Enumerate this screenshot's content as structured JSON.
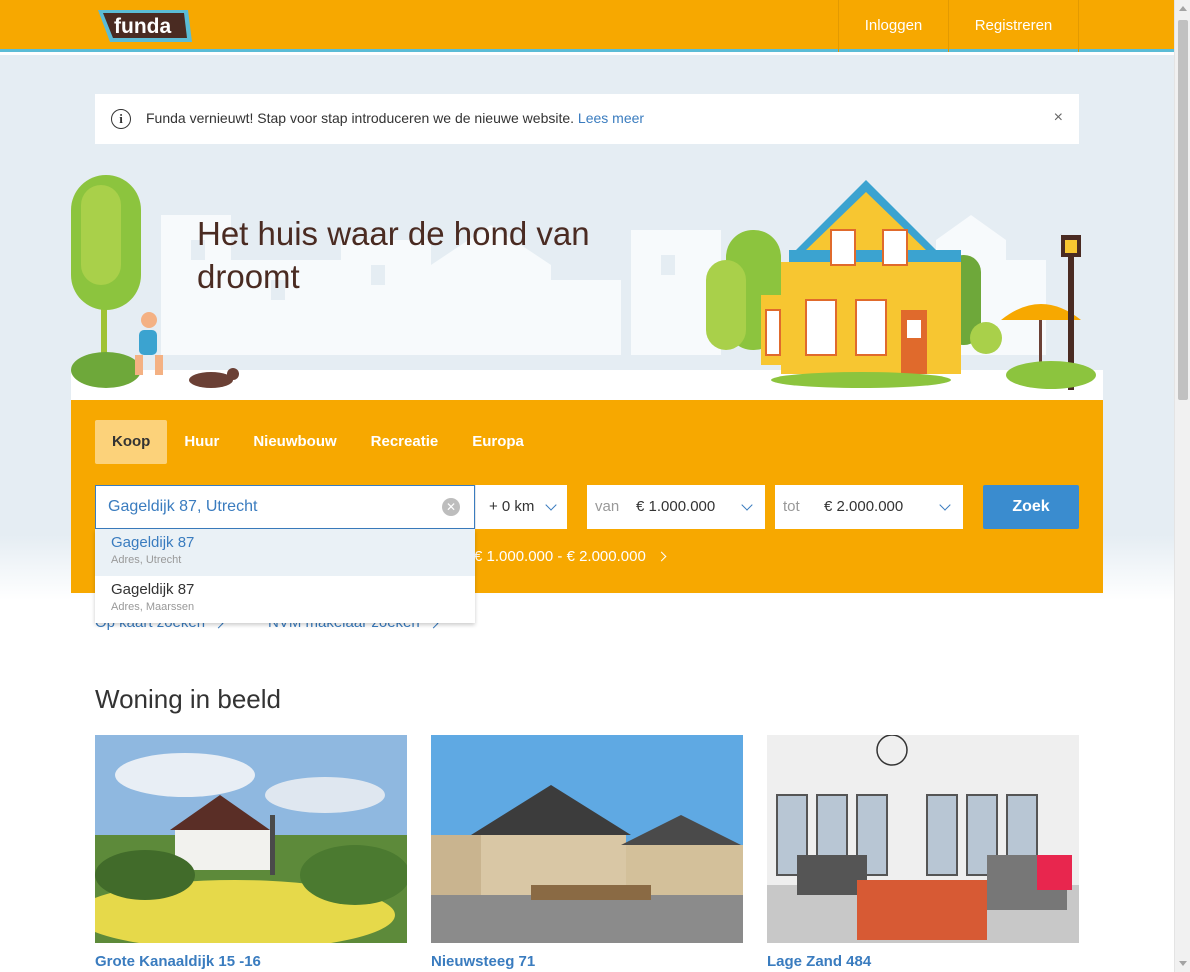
{
  "header": {
    "logo_text": "funda",
    "login_label": "Inloggen",
    "register_label": "Registreren"
  },
  "notice": {
    "icon": "info-icon",
    "text": "Funda vernieuwt! Stap voor stap introduceren we de nieuwe website.",
    "link_label": "Lees meer",
    "close_glyph": "×"
  },
  "hero": {
    "title": "Het huis waar de hond van droomt"
  },
  "search": {
    "tabs": [
      {
        "label": "Koop",
        "active": true
      },
      {
        "label": "Huur",
        "active": false
      },
      {
        "label": "Nieuwbouw",
        "active": false
      },
      {
        "label": "Recreatie",
        "active": false
      },
      {
        "label": "Europa",
        "active": false
      }
    ],
    "location_value": "Gageldijk 87, Utrecht",
    "radius_value": "+ 0 km",
    "price_from_label": "van",
    "price_from_value": "€ 1.000.000",
    "price_to_label": "tot",
    "price_to_value": "€ 2.000.000",
    "submit_label": "Zoek",
    "saved_search_text": "€ 1.000.000 - € 2.000.000"
  },
  "autocomplete": {
    "items": [
      {
        "title": "Gageldijk 87",
        "subtitle": "Adres, Utrecht",
        "active": true
      },
      {
        "title": "Gageldijk 87",
        "subtitle": "Adres, Maarssen",
        "active": false
      }
    ]
  },
  "sub_links": {
    "map_search": "Op kaart zoeken",
    "nvm_search": "NVM makelaar zoeken"
  },
  "featured": {
    "title": "Woning in beeld",
    "cards": [
      {
        "name": "Grote Kanaaldijk 15 -16"
      },
      {
        "name": "Nieuwsteeg 71"
      },
      {
        "name": "Lage Zand 484"
      }
    ]
  },
  "colors": {
    "brand": "#f7a800",
    "accent_blue": "#3a7cbf",
    "logo_outline": "#5bbcd6"
  }
}
